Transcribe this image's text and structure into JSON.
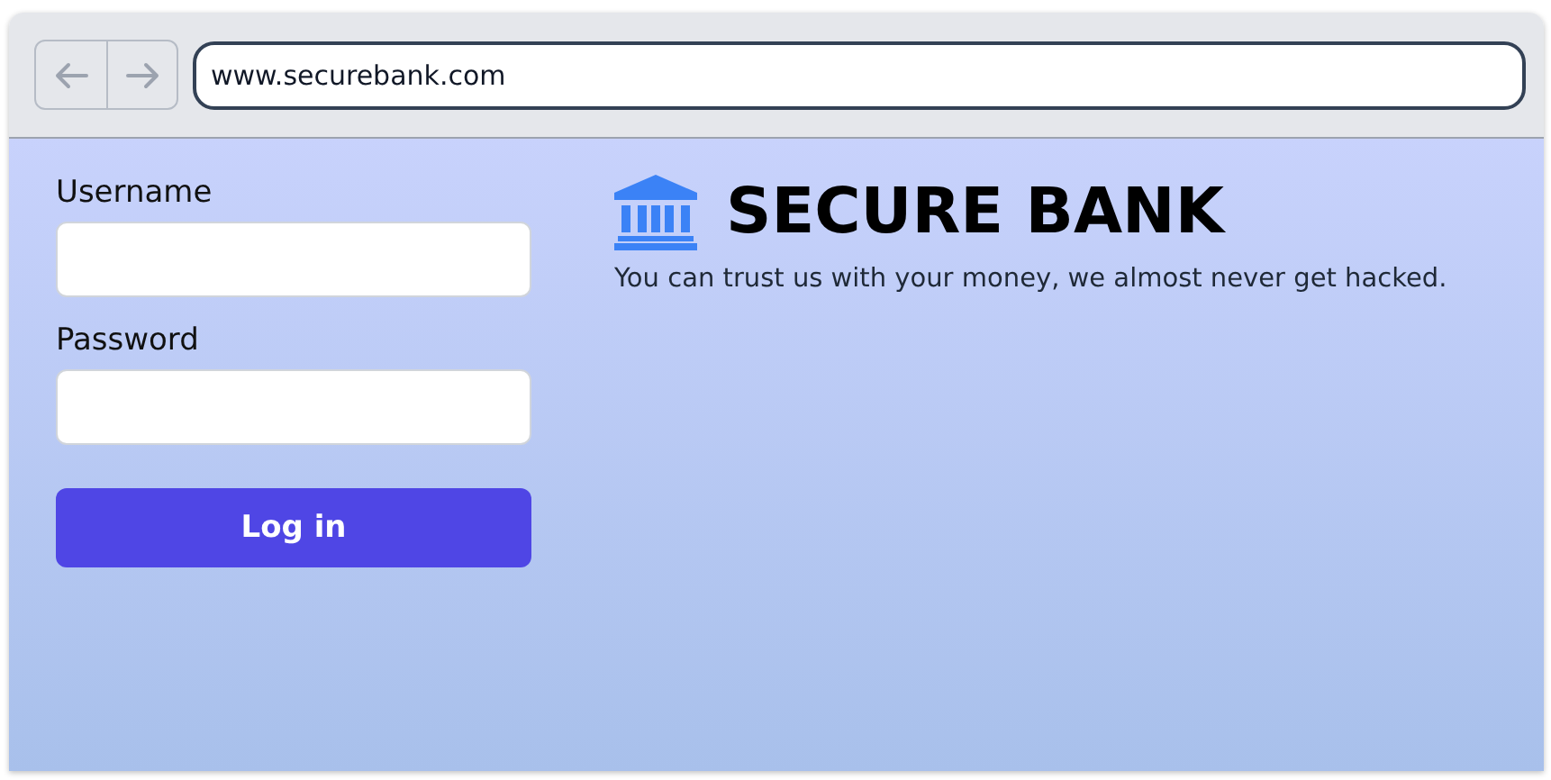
{
  "browser": {
    "nav_buttons": [
      {
        "kind": "back",
        "disabled": true
      },
      {
        "kind": "forward",
        "disabled": true
      }
    ],
    "address": "www.securebank.com"
  },
  "login": {
    "fields": [
      {
        "label": "Username"
      },
      {
        "label": "Password"
      }
    ],
    "button": "Log in"
  },
  "brand": {
    "title": "SECURE BANK",
    "tagline": "You can trust us with your money, we almost never get hacked."
  }
}
